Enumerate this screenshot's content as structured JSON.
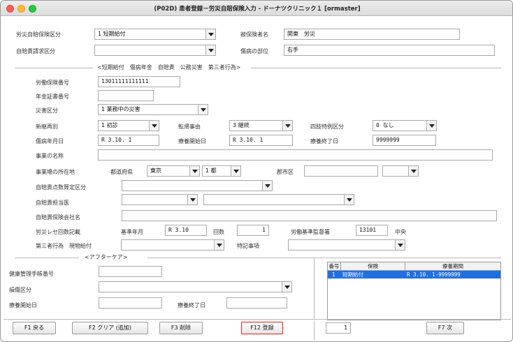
{
  "window": {
    "title": "(P02D) 患者登録－労災自賠保険入力 - ドーナツクリニック１ [ormaster]"
  },
  "top": {
    "insurance_type_label": "労災自賠保険区分",
    "insurance_type_value": "1 短期給付",
    "insured_name_label": "被保険者名",
    "insured_name_value": "関東　労災",
    "liability_claim_label": "自賠責請求区分",
    "liability_claim_value": "",
    "injury_site_label": "傷病の部位",
    "injury_site_value": "右手"
  },
  "sections": {
    "types_header": "<短期給付　傷病年金　自賠責　公務災害　第三者行為>",
    "aftercare_header": "<アフターケア>"
  },
  "mid": {
    "labor_no_label": "労働保険番号",
    "labor_no_value": "13011111111111",
    "pension_label": "年金証書番号",
    "pension_value": "",
    "disaster_label": "災害区分",
    "disaster_value": "1 業務中の災害",
    "new_label": "新継再別",
    "new_value": "1 初診",
    "outcome_label": "転帰事由",
    "outcome_value": "3 継続",
    "limb_label": "四肢特例区分",
    "limb_value": "0 なし",
    "injury_date_label": "傷病年月日",
    "injury_date_value": "R 3.10. 1",
    "treat_start_label": "療養開始日",
    "treat_start_value": "R 3.10. 1",
    "treat_end_label": "療養終了日",
    "treat_end_value": "9999999",
    "business_label": "事業の名称",
    "business_value": "",
    "location_label": "事業場の所在地",
    "prefecture_label": "都道府県",
    "prefecture_value": "東京",
    "prefecture_code_value": "1 都",
    "city_label": "郡市区",
    "city_value": "",
    "city_select_value": "",
    "liability_points_label": "自賠責点数算定区分",
    "liability_points_value": "",
    "doctor_label": "自賠責担当医",
    "doctor_value": "",
    "doctor_name_value": "",
    "insurer_label": "自賠責保険会社名",
    "insurer_value": "",
    "receipt_label": "労災レセ回数記載",
    "base_month_label": "基準年月",
    "base_month_value": "R 3.10",
    "count_label": "回数",
    "count_value": "1",
    "labor_office_label": "労働基準監督署",
    "labor_office_code": "13101",
    "labor_office_name": "中央",
    "third_party_label": "第三者行為　現物給付",
    "third_party_value": "",
    "special_label": "特記事項",
    "special_value": ""
  },
  "after": {
    "handbook_label": "健康管理手帳番号",
    "handbook_value": "",
    "injury_label": "損傷区分",
    "injury_value": "",
    "start_label": "療養開始日",
    "start_value": "",
    "end_label": "療養終了日",
    "end_value": ""
  },
  "table": {
    "headers": [
      "番号",
      "保険",
      "療養期間"
    ],
    "rows": [
      {
        "no": "1",
        "insurance": "短期給付",
        "period": "R 3.10. 1-9999999"
      }
    ]
  },
  "footer": {
    "f1": "F1 戻る",
    "f2": "F2 クリア (追加)",
    "f3": "F3 削除",
    "f12": "F12 登録",
    "page": "1",
    "f7": "F7 次"
  },
  "colors": {
    "selection": "#1f6fe0",
    "highlight_border": "#e02020"
  }
}
